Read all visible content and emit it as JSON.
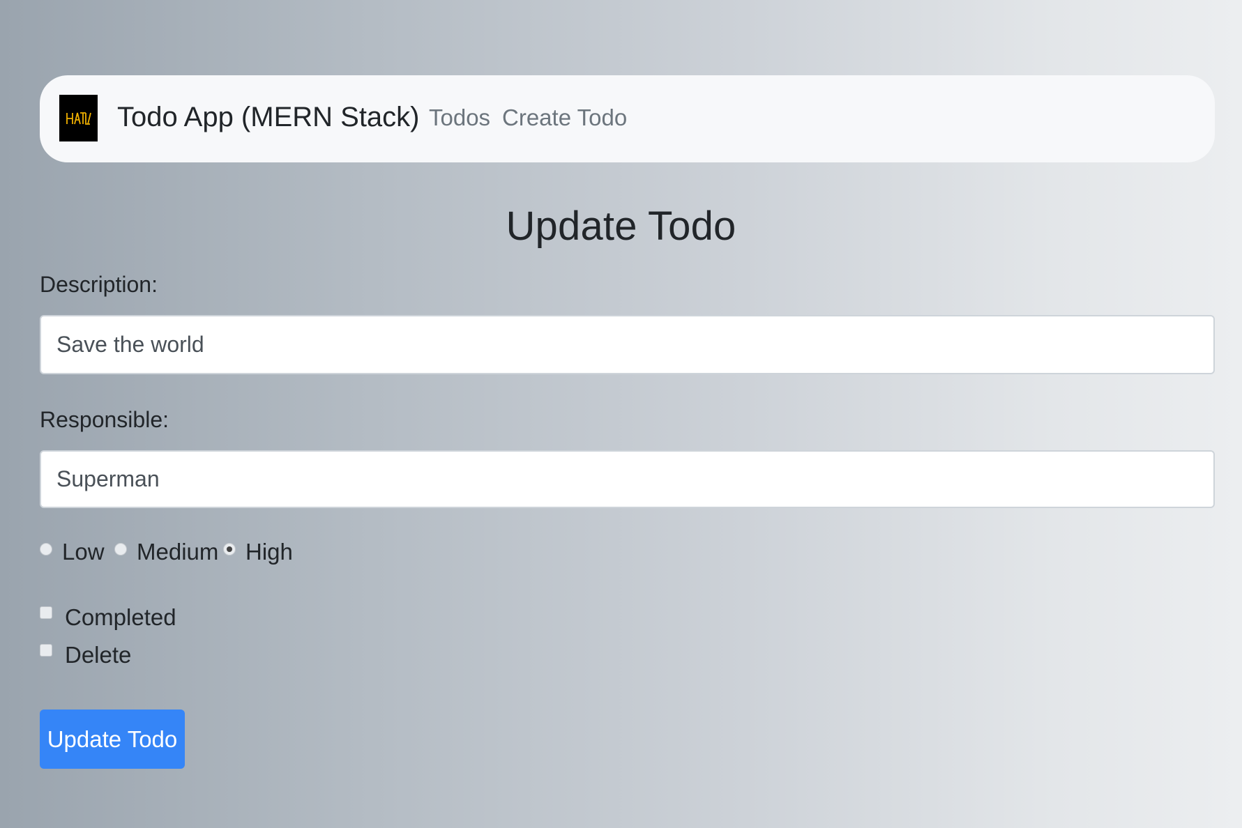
{
  "navbar": {
    "logo_icon": "hatla-logo-icon",
    "logo_text": "HATLA",
    "brand": "Todo App (MERN Stack)",
    "links": [
      {
        "label": "Todos"
      },
      {
        "label": "Create Todo"
      }
    ]
  },
  "page": {
    "title": "Update Todo"
  },
  "form": {
    "description": {
      "label": "Description:",
      "value": "Save the world"
    },
    "responsible": {
      "label": "Responsible:",
      "value": "Superman"
    },
    "priority": {
      "options": [
        {
          "label": "Low",
          "checked": false
        },
        {
          "label": "Medium",
          "checked": false
        },
        {
          "label": "High",
          "checked": true
        }
      ]
    },
    "checkboxes": [
      {
        "label": "Completed",
        "checked": false
      },
      {
        "label": "Delete",
        "checked": false
      }
    ],
    "submit_label": "Update Todo"
  },
  "colors": {
    "primary_button": "#3585f7",
    "navbar_bg": "#f7f8fa",
    "logo_bg": "#000000",
    "logo_accent": "#f0b000"
  }
}
